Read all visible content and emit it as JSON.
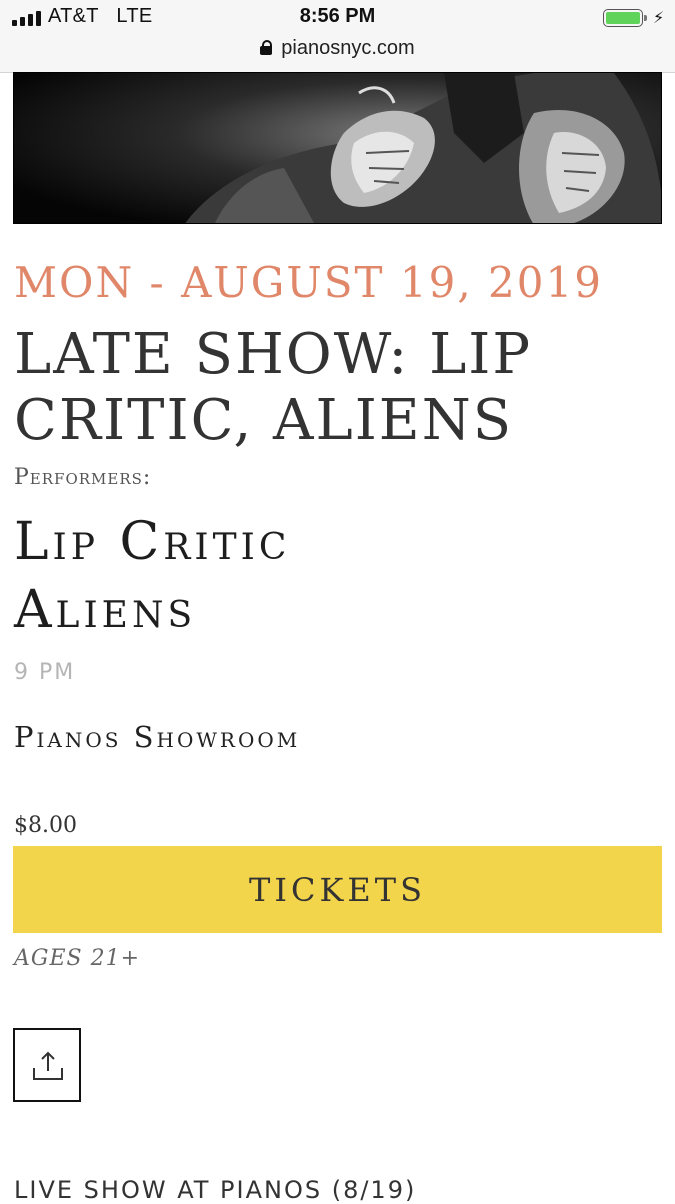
{
  "status_bar": {
    "carrier": "AT&T",
    "network": "LTE",
    "time": "8:56 PM",
    "url": "pianosnyc.com",
    "battery_color": "#5fd35a"
  },
  "event": {
    "date": "MON - AUGUST 19, 2019",
    "title": "LATE SHOW: LIP CRITIC, ALIENS",
    "performers_label": "Performers:",
    "performers": [
      "Lip Critic",
      "Aliens"
    ],
    "time": "9 PM",
    "venue": "Pianos Showroom",
    "price": "$8.00",
    "tickets_label": "TICKETS",
    "age_restriction": "AGES 21+"
  },
  "share": {
    "icon": "share-icon"
  },
  "footer": {
    "next_title": "LIVE SHOW AT PIANOS (8/19)"
  },
  "colors": {
    "date": "#e0876a",
    "tickets_button": "#f3d54b",
    "title": "#333333"
  }
}
